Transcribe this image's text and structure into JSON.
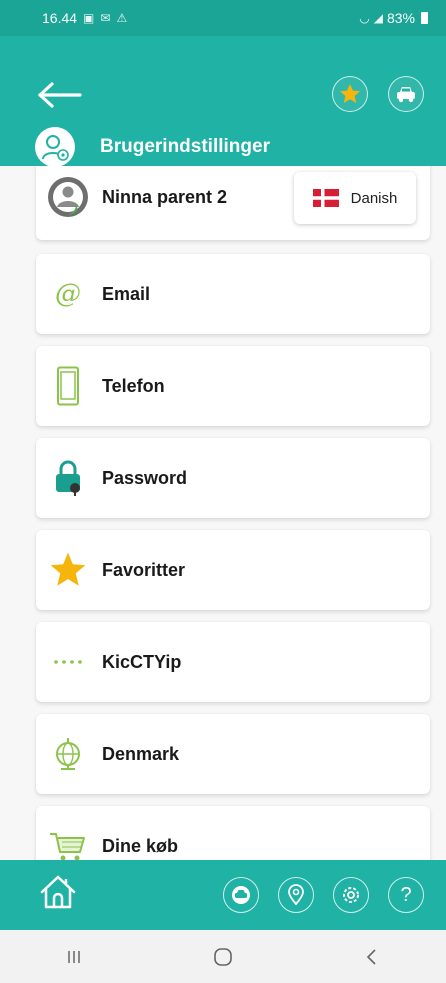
{
  "status_bar": {
    "time": "16.44",
    "battery": "83%"
  },
  "header": {
    "title": "Brugerindstillinger"
  },
  "profile": {
    "name": "Ninna parent 2",
    "language": "Danish"
  },
  "menu": [
    {
      "label": "Email",
      "icon": "at-icon"
    },
    {
      "label": "Telefon",
      "icon": "phone-icon"
    },
    {
      "label": "Password",
      "icon": "lock-icon"
    },
    {
      "label": "Favoritter",
      "icon": "star-icon"
    },
    {
      "label": "KicCTYip",
      "icon": "password-dots-icon"
    },
    {
      "label": "Denmark",
      "icon": "globe-icon"
    },
    {
      "label": "Dine køb",
      "icon": "cart-icon"
    }
  ],
  "colors": {
    "teal": "#20b2a4",
    "dark_teal": "#0f7c72",
    "star": "#f5b50a",
    "lock": "#1a9e90",
    "green": "#8bc34a",
    "denmark_red": "#d81e35"
  }
}
